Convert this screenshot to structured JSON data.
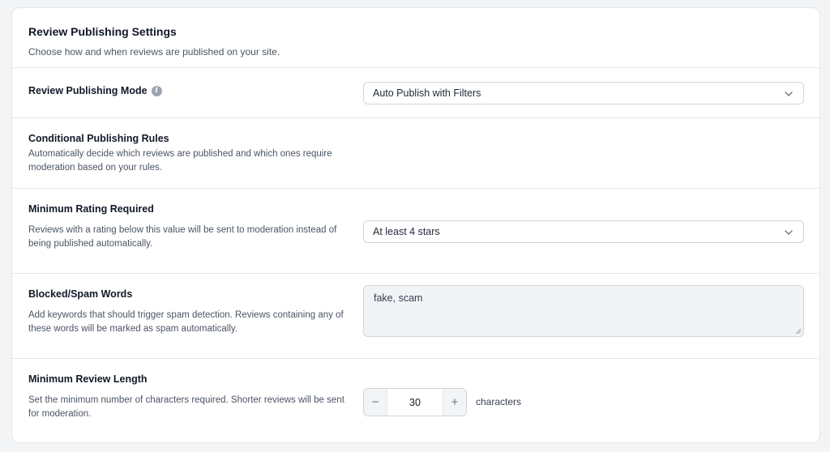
{
  "header": {
    "title": "Review Publishing Settings",
    "subtitle": "Choose how and when reviews are published on your site."
  },
  "publishing_mode": {
    "label": "Review Publishing Mode",
    "info_icon": "info-icon",
    "selected": "Auto Publish with Filters"
  },
  "conditional_rules": {
    "title": "Conditional Publishing Rules",
    "description": "Automatically decide which reviews are published and which ones require moderation based on your rules."
  },
  "minimum_rating": {
    "title": "Minimum Rating Required",
    "description": "Reviews with a rating below this value will be sent to moderation instead of being published automatically.",
    "selected": "At least 4 stars"
  },
  "spam_words": {
    "title": "Blocked/Spam Words",
    "description": "Add keywords that should trigger spam detection. Reviews containing any of these words will be marked as spam automatically.",
    "value": "fake, scam"
  },
  "min_length": {
    "title": "Minimum Review Length",
    "description": "Set the minimum number of characters required. Shorter reviews will be sent for moderation.",
    "decrement": "−",
    "value": "30",
    "increment": "+",
    "unit": "characters"
  }
}
